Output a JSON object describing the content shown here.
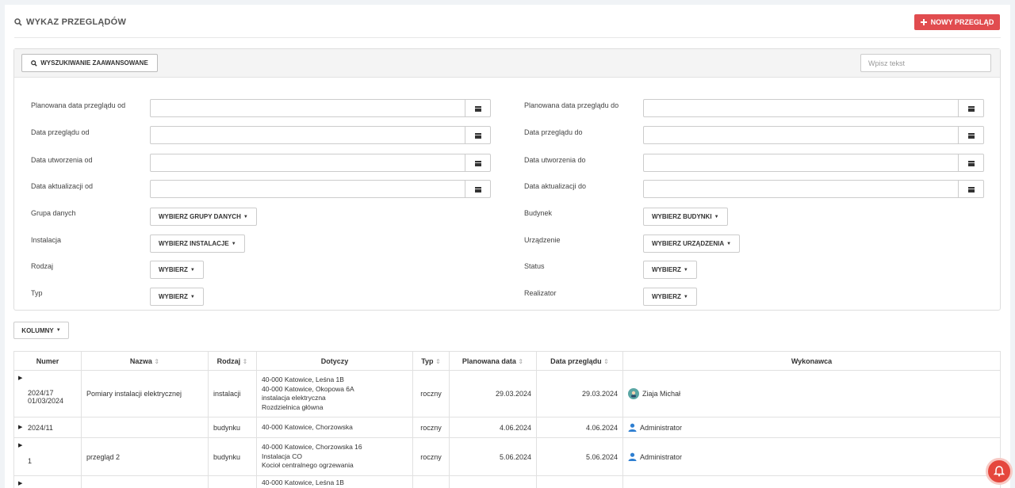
{
  "header": {
    "title": "WYKAZ PRZEGLĄDÓW",
    "new_button": "NOWY PRZEGLĄD"
  },
  "filters": {
    "advanced_button": "WYSZUKIWANIE ZAAWANSOWANE",
    "search_placeholder": "Wpisz tekst",
    "planned_from": "Planowana data przeglądu od",
    "planned_to": "Planowana data przeglądu do",
    "review_from": "Data przeglądu od",
    "review_to": "Data przeglądu do",
    "created_from": "Data utworzenia od",
    "created_to": "Data utworzenia do",
    "updated_from": "Data aktualizacji od",
    "updated_to": "Data aktualizacji do",
    "group_label": "Grupa danych",
    "group_button": "WYBIERZ GRUPY DANYCH",
    "building_label": "Budynek",
    "building_button": "WYBIERZ BUDYNKI",
    "installation_label": "Instalacja",
    "installation_button": "WYBIERZ INSTALACJE",
    "device_label": "Urządzenie",
    "device_button": "WYBIERZ URZĄDZENIA",
    "kind_label": "Rodzaj",
    "kind_button": "WYBIERZ",
    "status_label": "Status",
    "status_button": "WYBIERZ",
    "type_label": "Typ",
    "type_button": "WYBIERZ",
    "realizer_label": "Realizator",
    "realizer_button": "WYBIERZ"
  },
  "columns_button": "KOLUMNY",
  "table": {
    "headers": {
      "numer": "Numer",
      "nazwa": "Nazwa",
      "rodzaj": "Rodzaj",
      "dotyczy": "Dotyczy",
      "typ": "Typ",
      "planowana": "Planowana data",
      "data": "Data przeglądu",
      "wykonawca": "Wykonawca"
    },
    "rows": [
      {
        "numer_1": "2024/17",
        "numer_2": "01/03/2024",
        "nazwa": "Pomiary instalacji elektrycznej",
        "rodzaj": "instalacji",
        "dotyczy": [
          "40-000 Katowice, Leśna 1B",
          "40-000 Katowice, Okopowa 6A",
          "instalacja elektryczna",
          "Rozdzielnica główna"
        ],
        "typ": "roczny",
        "planowana": "29.03.2024",
        "data": "29.03.2024",
        "wykonawca": "Ziaja Michał"
      },
      {
        "numer_1": "2024/11",
        "nazwa": "",
        "rodzaj": "budynku",
        "dotyczy": [
          "40-000 Katowice, Chorzowska"
        ],
        "typ": "roczny",
        "planowana": "4.06.2024",
        "data": "4.06.2024",
        "wykonawca": "Administrator"
      },
      {
        "numer_1": "1",
        "nazwa": "przegląd 2",
        "rodzaj": "budynku",
        "dotyczy": [
          "40-000 Katowice, Chorzowska 16",
          "Instalacja CO",
          "Kocioł centralnego ogrzewania"
        ],
        "typ": "roczny",
        "planowana": "5.06.2024",
        "data": "5.06.2024",
        "wykonawca": "Administrator"
      },
      {
        "dotyczy": [
          "40-000 Katowice, Leśna 1B"
        ]
      }
    ]
  },
  "colors": {
    "accent": "#e14c4f",
    "user_icon": "#2f7fd1"
  }
}
